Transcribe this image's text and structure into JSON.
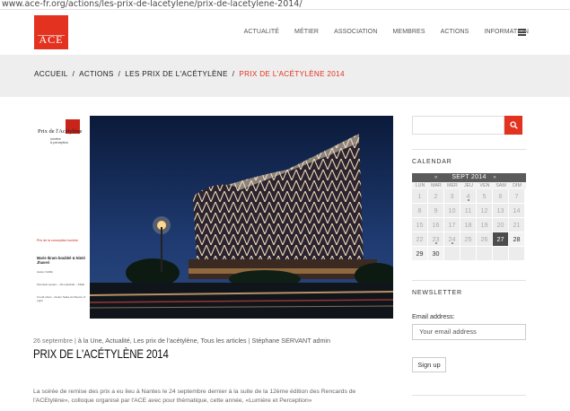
{
  "browser": {
    "url": "www.ace-fr.org/actions/les-prix-de-lacetylene/prix-de-lacetylene-2014/"
  },
  "header": {
    "logo_text": "ACE",
    "nav": [
      "Actualité",
      "Métier",
      "Association",
      "Membres",
      "Actions",
      "Information"
    ]
  },
  "breadcrumb": {
    "items": [
      "Accueil",
      "Actions",
      "Les prix de l'acétylène"
    ],
    "current": "Prix de l'Acétylène 2014"
  },
  "poster": {
    "title": "Prix de l'Acétylène",
    "subtitle_line1": "lumière",
    "subtitle_line2": "& perception",
    "category": "Prix de la conception lumière",
    "winners": "Marie Ikram boublel & Nimit Jhaveri",
    "agency": "Atelier SABA",
    "project": "Mondeal square – Ahmedabad – INDE",
    "credit": "Credit photo : Atelier Saba-Architects of Light"
  },
  "post": {
    "date": "26 septembre",
    "categories": "à la Une, Actualité, Les prix de l'acétylène, Tous les articles",
    "author": "Stéphane SERVANT admin",
    "title": "PRIX DE L'ACÉTYLÈNE 2014",
    "excerpt": "La soirée de remise des prix a eu lieu à Nantes le 24 septembre dernier à la suite de la 12ème édition des Rencards de l'ACEtylène», colloque organisé par l'ACE avec pour thématique, cette année, «Lumière et Perception»"
  },
  "sidebar": {
    "calendar_heading": "Calendar",
    "calendar": {
      "month": "SEPT 2014",
      "prev": "«",
      "next": "»",
      "dows": [
        "LUN",
        "MAR",
        "MER",
        "JEU",
        "VEN",
        "SAM",
        "DIM"
      ],
      "weeks": [
        [
          "1",
          "2",
          "3",
          "4",
          "5",
          "6",
          "7"
        ],
        [
          "8",
          "9",
          "10",
          "11",
          "12",
          "13",
          "14"
        ],
        [
          "15",
          "16",
          "17",
          "18",
          "19",
          "20",
          "21"
        ],
        [
          "22",
          "23",
          "24",
          "25",
          "26",
          "27",
          "28"
        ],
        [
          "29",
          "30",
          "",
          "",
          "",
          "",
          ""
        ]
      ]
    },
    "newsletter_heading": "Newsletter",
    "email_label": "Email address:",
    "email_placeholder": "Your email address",
    "signup_label": "Sign up"
  },
  "colors": {
    "accent": "#e3321f",
    "band": "#eeeeee"
  }
}
